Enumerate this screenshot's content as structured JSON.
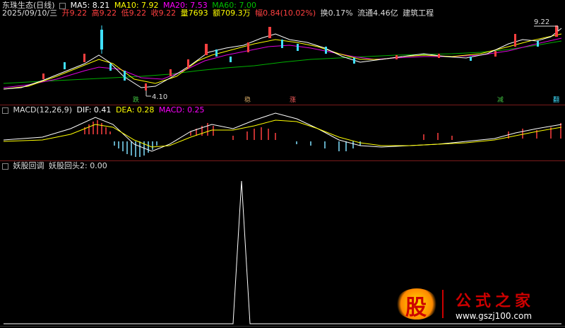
{
  "header": {
    "stock_name": "东珠生态(日线)",
    "ma5": "MA5: 8.21",
    "ma10": "MA10: 7.92",
    "ma20": "MA20: 7.53",
    "ma60": "MA60: 7.00"
  },
  "quote": {
    "date": "2025/09/10/三",
    "open": "开9.22",
    "high": "高9.22",
    "low": "低9.22",
    "close": "收9.22",
    "volume": "量7693",
    "amount": "额709.3万",
    "change": "幅0.84(10.02%)",
    "turnover": "换0.17%",
    "float_cap": "流通4.46亿",
    "industry": "建筑工程"
  },
  "price_panel": {
    "high_label": "9.22",
    "low_label": "4.10",
    "signals": [
      "跌",
      "稳",
      "涨",
      "减",
      "翻"
    ]
  },
  "macd_panel": {
    "title": "MACD(12,26,9)",
    "dif": "DIF: 0.41",
    "dea": "DEA: 0.28",
    "macd": "MACD: 0.25"
  },
  "indicator_panel": {
    "title": "妖股回调",
    "value": "妖股回头2: 0.00"
  },
  "watermark": {
    "logo_char": "股",
    "site_name": "公式之家",
    "url": "www.gszj100.com"
  },
  "colors": {
    "ma5": "#ffffff",
    "ma10": "#ffff00",
    "ma20": "#ff00ff",
    "ma60": "#00c000",
    "up": "#ff4040",
    "down": "#40e0ff"
  }
}
